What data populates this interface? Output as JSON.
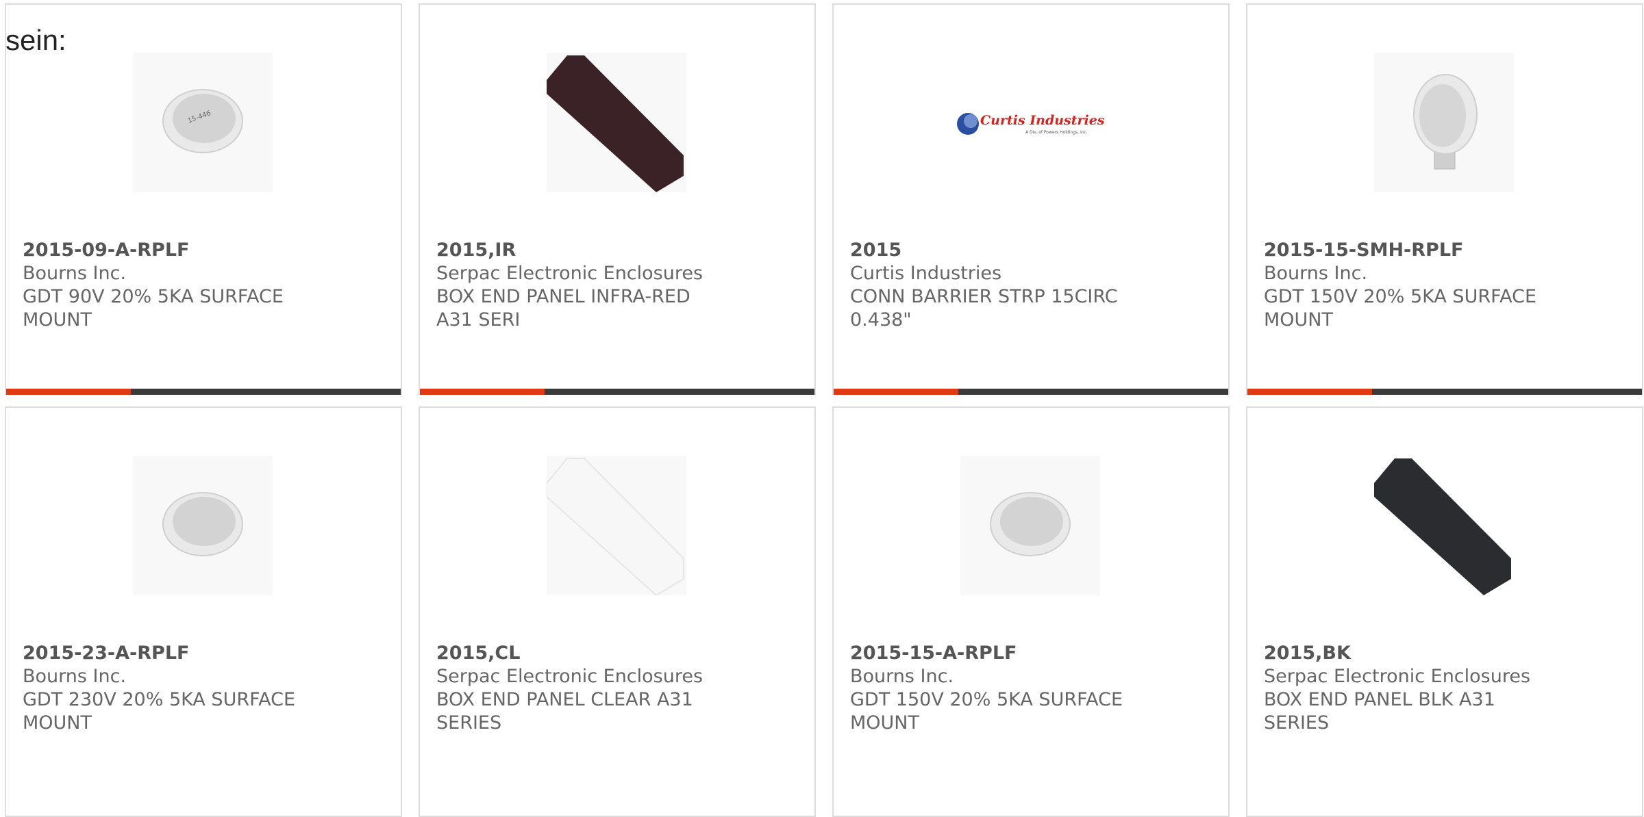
{
  "intro_text": "sein:",
  "accent_color": "#e03a12",
  "bar_color": "#3a3a3a",
  "products": [
    {
      "part_number": "2015-09-A-RPLF",
      "manufacturer": "Bourns Inc.",
      "description": "GDT 90V 20% 5KA SURFACE MOUNT",
      "image": "gdt-disc"
    },
    {
      "part_number": "2015,IR",
      "manufacturer": "Serpac Electronic Enclosures",
      "description": "BOX END PANEL INFRA-RED A31 SERI",
      "image": "panel-dark-red"
    },
    {
      "part_number": "2015",
      "manufacturer": "Curtis Industries",
      "description": "CONN BARRIER STRP 15CIRC 0.438\"",
      "image": "curtis-logo",
      "logo_text": "Curtis Industries",
      "logo_subtext": "A Div. of Powers Holdings, Inc."
    },
    {
      "part_number": "2015-15-SMH-RPLF",
      "manufacturer": "Bourns Inc.",
      "description": "GDT 150V 20% 5KA SURFACE MOUNT",
      "image": "gdt-smh"
    },
    {
      "part_number": "2015-23-A-RPLF",
      "manufacturer": "Bourns Inc.",
      "description": "GDT 230V 20% 5KA SURFACE MOUNT",
      "image": "gdt-disc"
    },
    {
      "part_number": "2015,CL",
      "manufacturer": "Serpac Electronic Enclosures",
      "description": "BOX END PANEL CLEAR A31 SERIES",
      "image": "panel-clear"
    },
    {
      "part_number": "2015-15-A-RPLF",
      "manufacturer": "Bourns Inc.",
      "description": "GDT 150V 20% 5KA SURFACE MOUNT",
      "image": "gdt-disc"
    },
    {
      "part_number": "2015,BK",
      "manufacturer": "Serpac Electronic Enclosures",
      "description": "BOX END PANEL BLK A31 SERIES",
      "image": "panel-black"
    }
  ]
}
